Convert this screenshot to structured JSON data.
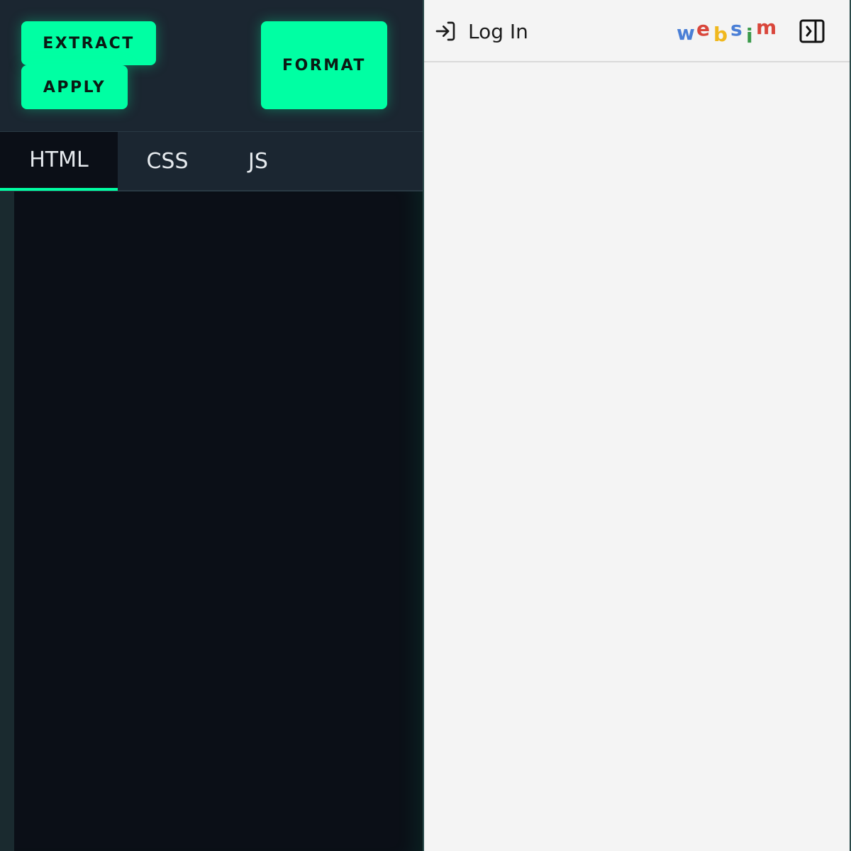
{
  "toolbar": {
    "extract_label": "EXTRACT",
    "apply_label": "APPLY",
    "format_label": "FORMAT",
    "accent_color": "#00ffa3"
  },
  "tabs": [
    {
      "label": "HTML",
      "active": true
    },
    {
      "label": "CSS",
      "active": false
    },
    {
      "label": "JS",
      "active": false
    }
  ],
  "editor": {
    "content": "",
    "background_color": "#0b0f17"
  },
  "preview": {
    "login_label": "Log In",
    "login_icon": "log-in-icon",
    "logo": {
      "letters": [
        {
          "char": "w",
          "color": "#4a7fd6"
        },
        {
          "char": "e",
          "color": "#d9463b"
        },
        {
          "char": "b",
          "color": "#f0b81e"
        },
        {
          "char": "s",
          "color": "#4a7fd6"
        },
        {
          "char": "i",
          "color": "#3a9a4a"
        },
        {
          "char": "m",
          "color": "#d9463b"
        }
      ]
    },
    "sidebar_toggle_icon": "sidebar-toggle-icon"
  }
}
